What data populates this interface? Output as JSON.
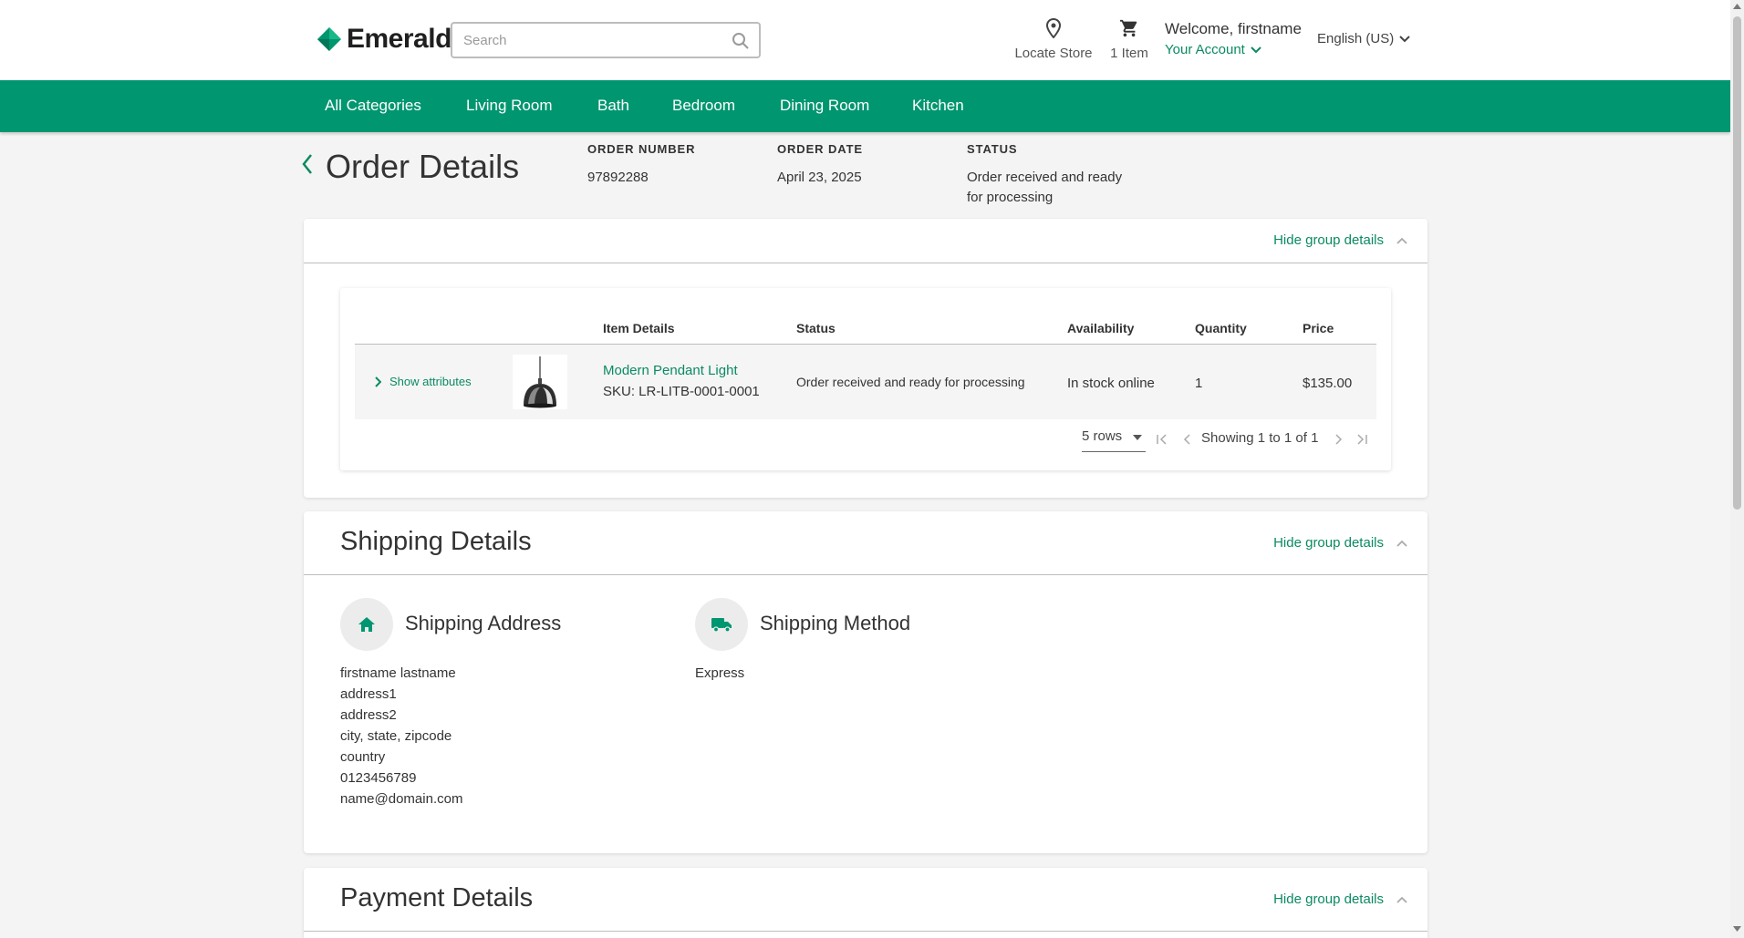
{
  "header": {
    "logo": "Emerald",
    "search_placeholder": "Search",
    "locate_store": "Locate Store",
    "cart_count": "1 Item",
    "welcome": "Welcome, firstname",
    "your_account": "Your Account",
    "language": "English (US)"
  },
  "nav": {
    "items": [
      "All Categories",
      "Living Room",
      "Bath",
      "Bedroom",
      "Dining Room",
      "Kitchen"
    ]
  },
  "order": {
    "title": "Order Details",
    "number_label": "ORDER NUMBER",
    "number": "97892288",
    "date_label": "ORDER DATE",
    "date": "April 23, 2025",
    "status_label": "STATUS",
    "status": "Order received and ready for processing"
  },
  "items_group": {
    "hide_label": "Hide group details",
    "columns": [
      "Item Details",
      "Status",
      "Availability",
      "Quantity",
      "Price"
    ],
    "rows": [
      {
        "show_attributes": "Show attributes",
        "name": "Modern Pendant Light",
        "sku": "SKU: LR-LITB-0001-0001",
        "status": "Order received and ready for processing",
        "availability": "In stock online",
        "quantity": "1",
        "price": "$135.00"
      }
    ],
    "rows_per_page": "5 rows",
    "showing": "Showing 1 to 1 of 1"
  },
  "shipping": {
    "title": "Shipping Details",
    "hide_label": "Hide group details",
    "address_heading": "Shipping Address",
    "method_heading": "Shipping Method",
    "address_lines": [
      "firstname lastname",
      "address1",
      "address2",
      "city, state, zipcode",
      "country",
      "0123456789",
      "name@domain.com"
    ],
    "method": "Express"
  },
  "payment": {
    "title": "Payment Details",
    "hide_label": "Hide group details"
  },
  "colors": {
    "brand": "#009670",
    "link": "#0a8a62"
  }
}
